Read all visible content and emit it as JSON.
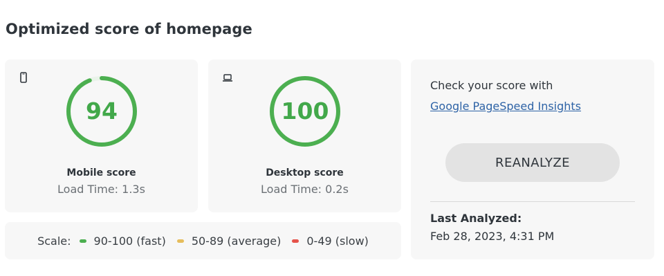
{
  "page_title": "Optimized score of homepage",
  "colors": {
    "fast": "#4caf50",
    "average": "#e6bd5c",
    "slow": "#e5534b"
  },
  "mobile": {
    "icon": "mobile-phone-icon",
    "score": "94",
    "label": "Mobile score",
    "load_time": "Load Time: 1.3s"
  },
  "desktop": {
    "icon": "laptop-icon",
    "score": "100",
    "label": "Desktop score",
    "load_time": "Load Time: 0.2s"
  },
  "scale": {
    "title": "Scale:",
    "items": [
      {
        "label": "90-100 (fast)",
        "color": "#4caf50"
      },
      {
        "label": "50-89 (average)",
        "color": "#e6bd5c"
      },
      {
        "label": "0-49 (slow)",
        "color": "#e5534b"
      }
    ]
  },
  "side": {
    "check_text": "Check your score with",
    "link_text": "Google PageSpeed Insights",
    "reanalyze_label": "REANALYZE",
    "last_analyzed_label": "Last Analyzed:",
    "last_analyzed_value": "Feb 28, 2023, 4:31 PM"
  }
}
